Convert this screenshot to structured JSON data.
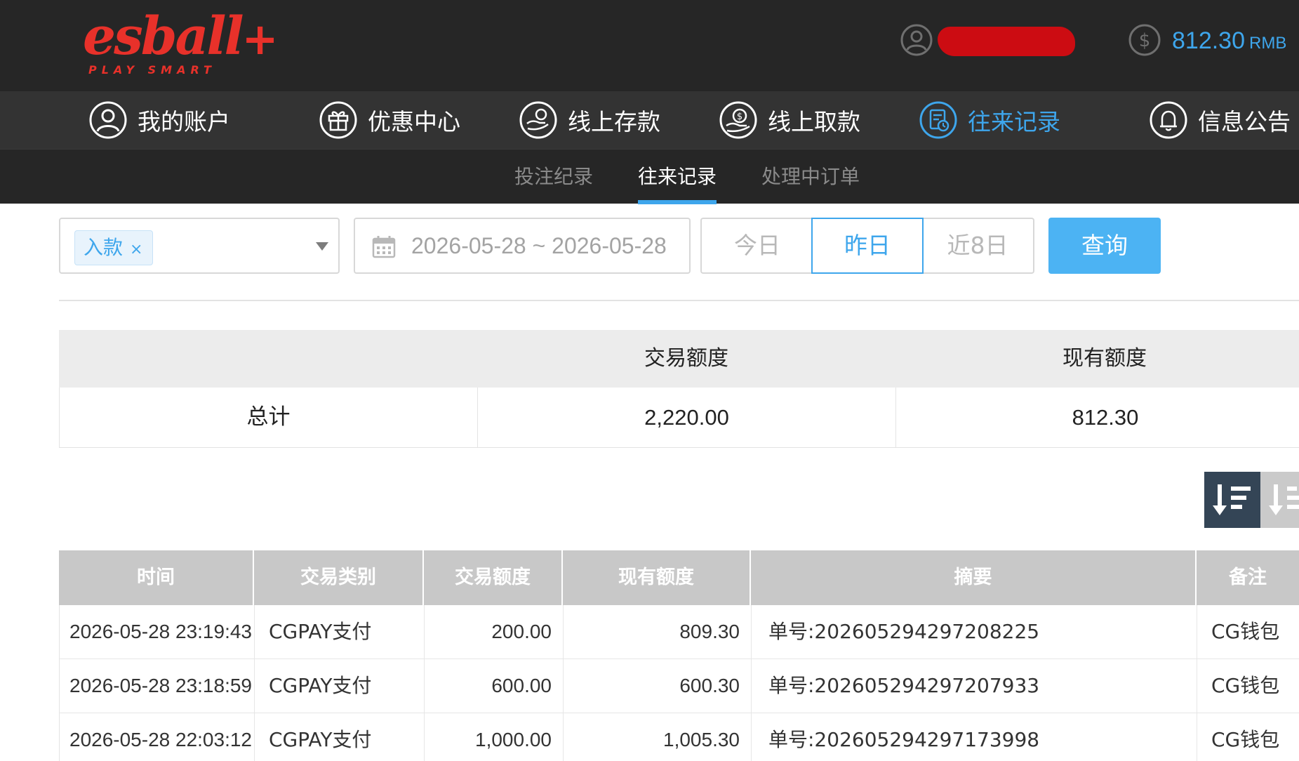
{
  "brand": {
    "logo_main": "esball",
    "logo_plus": "+",
    "logo_sub": "PLAY SMART",
    "accent_color": "#e8312a"
  },
  "header": {
    "user_icon": "user-circle-icon",
    "balance_icon": "dollar-circle-icon",
    "balance_amount": "812.30",
    "balance_currency": "RMB",
    "balance_color": "#3ea6ec"
  },
  "main_nav": {
    "items": [
      {
        "label": "我的账户",
        "icon": "user-circle-icon",
        "active": false
      },
      {
        "label": "优惠中心",
        "icon": "gift-icon",
        "active": false
      },
      {
        "label": "线上存款",
        "icon": "deposit-icon",
        "active": false
      },
      {
        "label": "线上取款",
        "icon": "withdraw-icon",
        "active": false
      },
      {
        "label": "往来记录",
        "icon": "record-icon",
        "active": true
      },
      {
        "label": "信息公告",
        "icon": "bell-icon",
        "active": false
      }
    ]
  },
  "sub_nav": {
    "tabs": [
      {
        "label": "投注纪录",
        "active": false
      },
      {
        "label": "往来记录",
        "active": true
      },
      {
        "label": "处理中订单",
        "active": false
      }
    ]
  },
  "filters": {
    "type_select": {
      "selected_tag": "入款",
      "tag_remove": "×"
    },
    "date_range": {
      "icon": "calendar-icon",
      "value": "2026-05-28 ~ 2026-05-28"
    },
    "quick_ranges": {
      "today": "今日",
      "yesterday": "昨日",
      "last8": "近8日",
      "selected": "昨日"
    },
    "query_button": "查询"
  },
  "summary": {
    "headers": [
      "",
      "交易额度",
      "现有额度"
    ],
    "row": {
      "label": "总计",
      "transaction_amount": "2,220.00",
      "current_balance": "812.30"
    }
  },
  "sort": {
    "desc_icon": "sort-desc-icon",
    "asc_icon": "sort-asc-icon",
    "active": "desc"
  },
  "records": {
    "headers": {
      "time": "时间",
      "type": "交易类别",
      "amount": "交易额度",
      "balance": "现有额度",
      "summary": "摘要",
      "note": "备注"
    },
    "rows": [
      {
        "time": "2026-05-28 23:19:43",
        "type": "CGPAY支付",
        "amount": "200.00",
        "balance": "809.30",
        "summary": "单号:202605294297208225",
        "note": "CG钱包"
      },
      {
        "time": "2026-05-28 23:18:59",
        "type": "CGPAY支付",
        "amount": "600.00",
        "balance": "600.30",
        "summary": "单号:202605294297207933",
        "note": "CG钱包"
      },
      {
        "time": "2026-05-28 22:03:12",
        "type": "CGPAY支付",
        "amount": "1,000.00",
        "balance": "1,005.30",
        "summary": "单号:202605294297173998",
        "note": "CG钱包"
      }
    ]
  }
}
